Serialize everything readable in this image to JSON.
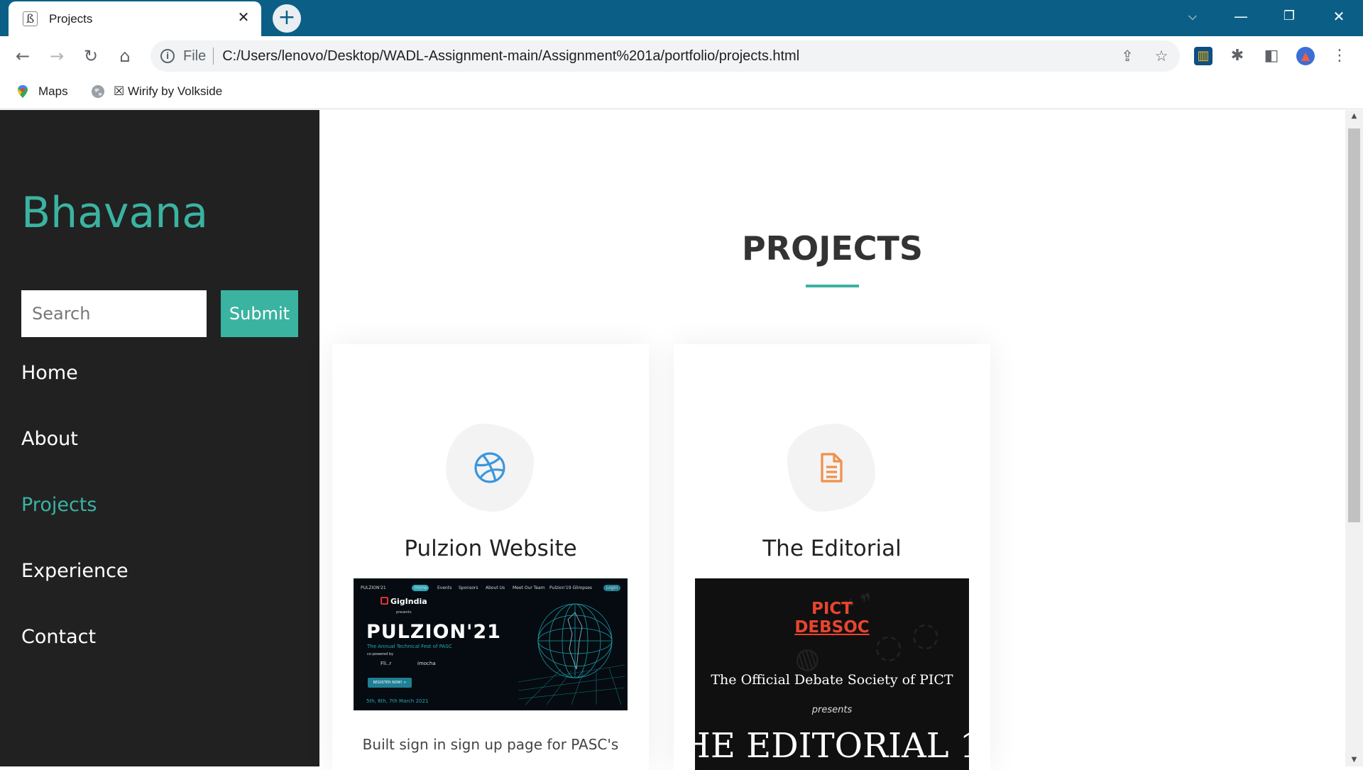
{
  "browser": {
    "tab_title": "Projects",
    "favicon_glyph": "ß",
    "new_tab_label": "+",
    "url_scheme": "File",
    "url": "C:/Users/lenovo/Desktop/WADL-Assignment-main/Assignment%201a/portfolio/projects.html",
    "bookmarks": [
      {
        "label": "Maps",
        "icon": "maps-pin-icon"
      },
      {
        "label": "☒ Wirify by Volkside",
        "icon": "globe-icon"
      }
    ],
    "colors": {
      "tabbar": "#0b5f86"
    }
  },
  "sidebar": {
    "brand": "Bhavana",
    "search_placeholder": "Search",
    "submit_label": "Submit",
    "nav": [
      {
        "label": "Home",
        "active": false
      },
      {
        "label": "About",
        "active": false
      },
      {
        "label": "Projects",
        "active": true
      },
      {
        "label": "Experience",
        "active": false
      },
      {
        "label": "Contact",
        "active": false
      }
    ],
    "colors": {
      "background": "#212121",
      "accent": "#3bb3a1"
    }
  },
  "main": {
    "section_title": "PROJECTS",
    "projects": [
      {
        "title": "Pulzion Website",
        "icon": "dribbble-icon",
        "icon_color": "#3a96dd",
        "description": "Built sign in sign up page for PASC's",
        "thumbnail": {
          "nav_text": "PULZION'21",
          "nav_links": [
            "Home",
            "Events",
            "Sponsors",
            "About Us",
            "Meet Our Team",
            "Pulzion'19 Glimpses",
            "Login"
          ],
          "brand": "GigIndia",
          "presents": "presents",
          "title": "PULZION'21",
          "subtitle": "The Annual Technical Fest of PASC",
          "powered": "co-powered by",
          "sponsor_1": "Fli..r",
          "sponsor_2": "imocha",
          "register": "REGISTER NOW! >",
          "date": "5th, 6th, 7th March 2021"
        }
      },
      {
        "title": "The Editorial",
        "icon": "document-icon",
        "icon_color": "#f0904a",
        "thumbnail": {
          "pict": "PICT",
          "debsoc": "DEBSOC",
          "official": "The Official Debate Society of PICT",
          "presents": "presents",
          "big_title": "HE EDITORIAL 1"
        }
      }
    ]
  }
}
